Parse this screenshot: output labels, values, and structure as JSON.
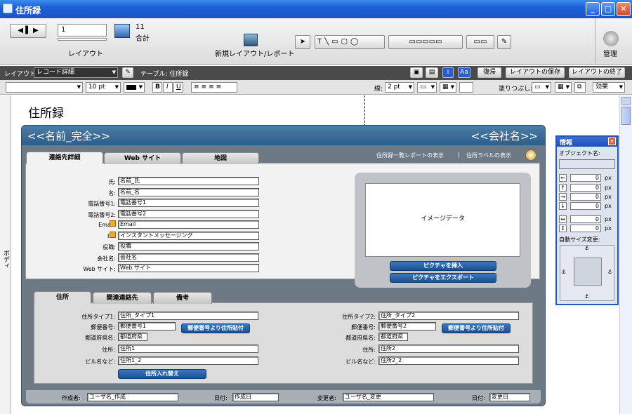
{
  "window": {
    "title": "住所録"
  },
  "toolbar": {
    "record_number": "1",
    "record_count": "11",
    "record_count_label": "合計",
    "layout_label": "レイアウト",
    "new_layout_label": "新規レイアウト/レポート",
    "manage_label": "管理"
  },
  "layoutbar": {
    "layout_prefix": "レイアウト:",
    "layout_value": "レコード詳細",
    "table_label": "テーブル: 住所録",
    "revert_label": "復帰",
    "save_label": "レイアウトの保存",
    "exit_label": "レイアウトの終了"
  },
  "formatbar": {
    "font_size": "10 pt",
    "bold": "B",
    "italic": "I",
    "underline": "U",
    "line_label": "線:",
    "line_value": "2 pt",
    "fill_label": "塗りつぶし:",
    "effect_label": "効果"
  },
  "canvas": {
    "page_title": "住所録",
    "body_label": "ボディ"
  },
  "record": {
    "name_field": "<<名前_完全>>",
    "company_field": "<<会社名>>",
    "list_report_link": "住所録一覧レポートの表示",
    "separator": "|",
    "label_report_link": "住所ラベルの表示",
    "tabs": [
      "連絡先詳細",
      "Web サイト",
      "地図"
    ],
    "contact_fields": [
      {
        "label": "氏:",
        "value": "名前_氏"
      },
      {
        "label": "名:",
        "value": "名前_名"
      },
      {
        "label": "電話番号1:",
        "value": "電話番号1"
      },
      {
        "label": "電話番号2:",
        "value": "電話番号2"
      },
      {
        "label": "Email:",
        "value": "Email"
      },
      {
        "label": "IM:",
        "value": "インスタントメッセージング"
      },
      {
        "label": "役職:",
        "value": "役職"
      },
      {
        "label": "会社名:",
        "value": "会社名"
      },
      {
        "label": "Web サイト:",
        "value": "Web サイト"
      }
    ],
    "image_placeholder": "イメージデータ",
    "insert_picture": "ピクチャを挿入",
    "export_picture": "ピクチャをエクスポート",
    "address_tabs": [
      "住所",
      "関連連絡先",
      "備考"
    ],
    "address1": [
      {
        "label": "住所タイプ1:",
        "value": "住所_タイプ1"
      },
      {
        "label": "郵便番号:",
        "value": "郵便番号1"
      },
      {
        "label": "都道府県名:",
        "value": "都道府県"
      },
      {
        "label": "住所:",
        "value": "住所1"
      },
      {
        "label": "ビル名など:",
        "value": "住所1_2"
      }
    ],
    "address2": [
      {
        "label": "住所タイプ2:",
        "value": "住所_タイプ2"
      },
      {
        "label": "郵便番号:",
        "value": "郵便番号2"
      },
      {
        "label": "都道府県名:",
        "value": "都道府県"
      },
      {
        "label": "住所:",
        "value": "住所2"
      },
      {
        "label": "ビル名など:",
        "value": "住所2_2"
      }
    ],
    "zip_paste_button": "郵便番号より住所貼付",
    "swap_address_button": "住所入れ替え",
    "footer": {
      "created_by_label": "作成者:",
      "created_by_value": "ユーザ名_作成",
      "created_date_label": "日付:",
      "created_date_value": "作成日",
      "modified_by_label": "変更者:",
      "modified_by_value": "ユーザ名_変更",
      "modified_date_label": "日付:",
      "modified_date_value": "変更日"
    }
  },
  "info_palette": {
    "title": "情報",
    "object_name_label": "オブジェクト名:",
    "values": [
      "0",
      "0",
      "0",
      "0",
      "0",
      "0"
    ],
    "unit": "px",
    "autosize_label": "自動サイズ変更:"
  }
}
